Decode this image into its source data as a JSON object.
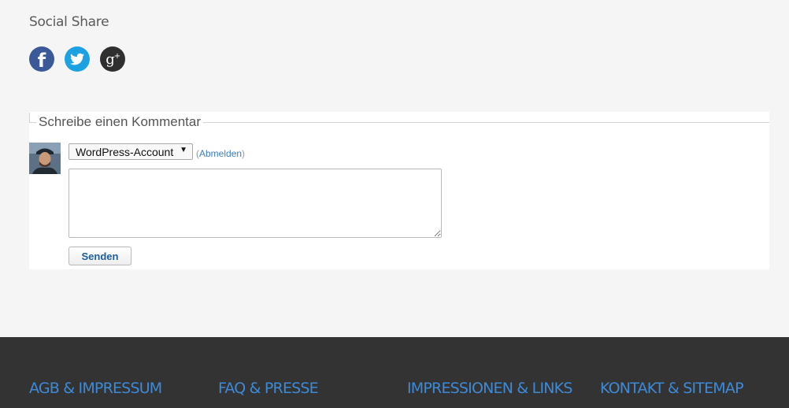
{
  "social": {
    "title": "Social Share",
    "icons": [
      {
        "name": "facebook-icon",
        "color": "#3b5998",
        "glyph": "f"
      },
      {
        "name": "twitter-icon",
        "color": "#1da1e2"
      },
      {
        "name": "google-plus-icon",
        "color": "#2f2f2f",
        "glyph": "g+"
      }
    ]
  },
  "comment": {
    "heading": "Schreibe einen Kommentar",
    "account_select": {
      "selected": "WordPress-Account",
      "arrow": "▼"
    },
    "logout_prefix": "(",
    "logout_label": "Abmelden",
    "logout_suffix": ")",
    "textarea_value": "",
    "submit_label": "Senden"
  },
  "footer": {
    "links": [
      {
        "label": "AGB & IMPRESSUM"
      },
      {
        "label": "FAQ & PRESSE"
      },
      {
        "label": "IMPRESSIONEN & LINKS"
      },
      {
        "label": "KONTAKT & SITEMAP"
      }
    ],
    "link_color": "#3e8ad7",
    "background": "#333333"
  }
}
